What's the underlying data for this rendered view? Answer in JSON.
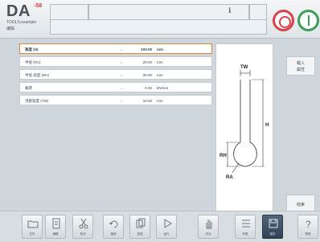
{
  "header": {
    "logo": "DA",
    "logo_sup": "-58",
    "subtitle": "TOOLS:example",
    "subtitle2": "编辑",
    "info_glyph": "ℹ"
  },
  "params": [
    {
      "label": "高度 (H)",
      "eq": "=",
      "value": "100.00",
      "unit": "mm",
      "selected": true
    },
    {
      "label": "半径 (RA)",
      "eq": "=",
      "value": "20.00",
      "unit": "mm"
    },
    {
      "label": "半径 高度 (RH)",
      "eq": "=",
      "value": "30.00",
      "unit": "mm"
    },
    {
      "label": "载荷",
      "eq": "=",
      "value": "0.30",
      "unit": "kN/mm"
    },
    {
      "label": "顶部宽度 (TW)",
      "eq": "=",
      "value": "10.00",
      "unit": "mm"
    }
  ],
  "diagram": {
    "labels": {
      "tw": "TW",
      "h": "H",
      "rh": "RH",
      "ra": "RA"
    }
  },
  "side_buttons": {
    "top": "载入\n属性",
    "bottom": "结束"
  },
  "toolbar": [
    {
      "icon": "folder-icon",
      "label": "文件"
    },
    {
      "icon": "document-icon",
      "label": "编辑"
    },
    {
      "icon": "cut-icon",
      "label": "剪切"
    },
    {
      "icon": "rotate-icon",
      "label": "旋转"
    },
    {
      "icon": "copy-icon",
      "label": "复制"
    },
    {
      "icon": "play-icon",
      "label": "运行"
    },
    {
      "icon": "hand-icon",
      "label": "手动"
    },
    {
      "icon": "list-icon",
      "label": "列表"
    },
    {
      "icon": "save-icon",
      "label": "保存",
      "active": true
    },
    {
      "icon": "help-icon",
      "label": "帮助"
    }
  ]
}
